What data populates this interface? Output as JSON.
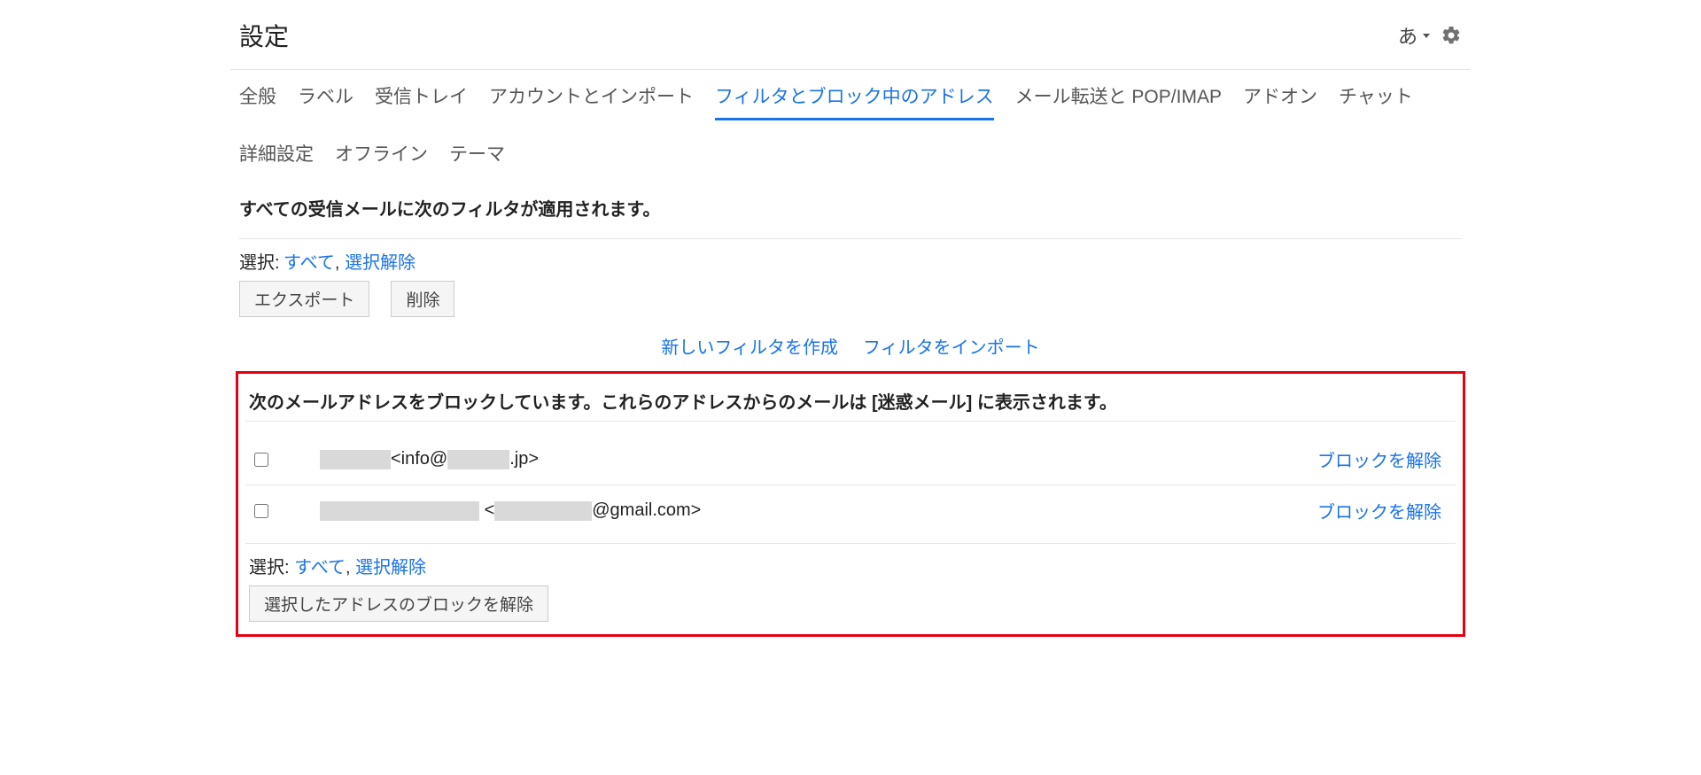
{
  "header": {
    "title": "設定",
    "ime": "あ"
  },
  "tabs": {
    "items": [
      {
        "label": "全般"
      },
      {
        "label": "ラベル"
      },
      {
        "label": "受信トレイ"
      },
      {
        "label": "アカウントとインポート"
      },
      {
        "label": "フィルタとブロック中のアドレス",
        "active": true
      },
      {
        "label": "メール転送と POP/IMAP"
      },
      {
        "label": "アドオン"
      },
      {
        "label": "チャット"
      },
      {
        "label": "詳細設定"
      },
      {
        "label": "オフライン"
      },
      {
        "label": "テーマ"
      }
    ]
  },
  "filters": {
    "heading": "すべての受信メールに次のフィルタが適用されます。",
    "select_label": "選択:",
    "select_all": "すべて",
    "select_none": "選択解除",
    "export": "エクスポート",
    "delete": "削除",
    "create_filter": "新しいフィルタを作成",
    "import_filters": "フィルタをインポート"
  },
  "blocked": {
    "heading": "次のメールアドレスをブロックしています。これらのアドレスからのメールは [迷惑メール] に表示されます。",
    "rows": [
      {
        "prefix": "<info@",
        "suffix": ".jp>"
      },
      {
        "prefix": "<",
        "mid": "@gmail.com>",
        "suffix": ""
      }
    ],
    "unblock_label": "ブロックを解除",
    "select_label": "選択:",
    "select_all": "すべて",
    "select_none": "選択解除",
    "bulk_unblock": "選択したアドレスのブロックを解除"
  }
}
